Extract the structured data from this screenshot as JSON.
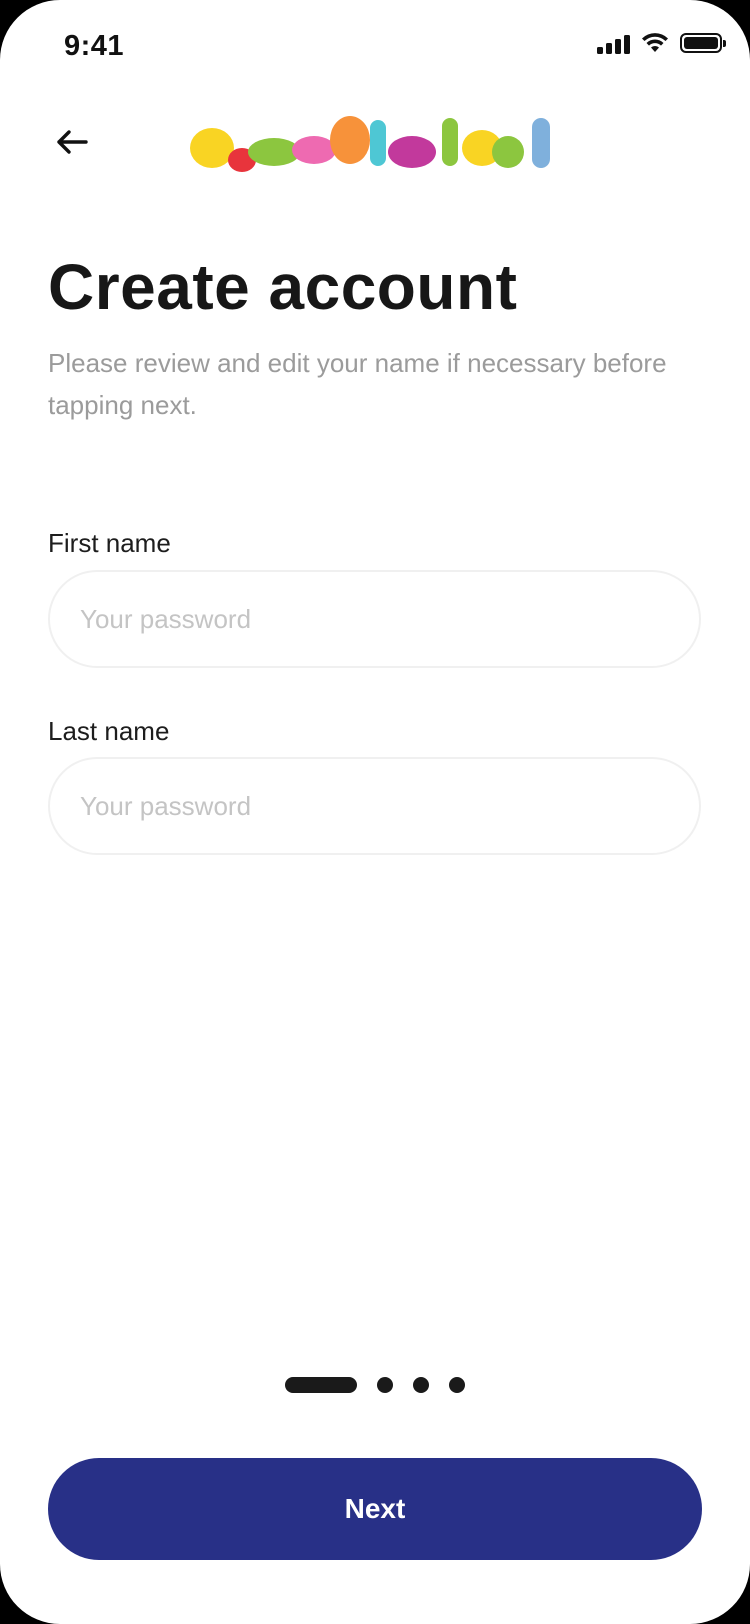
{
  "status_bar": {
    "time": "9:41",
    "icons": [
      "cellular-signal-icon",
      "wifi-icon",
      "battery-icon"
    ]
  },
  "header": {
    "back_icon": "arrow-left-icon",
    "logo_text": "العاب الحسين",
    "logo_colors": [
      "#f9d423",
      "#e8343c",
      "#8cc63f",
      "#f7923a",
      "#ee6ab1",
      "#4ec7d4",
      "#c2399c",
      "#f9d423",
      "#8cc63f",
      "#7fb0dc"
    ]
  },
  "page": {
    "title": "Create account",
    "subtitle": "Please review and edit your name if necessary before tapping next."
  },
  "form": {
    "first_name": {
      "label": "First name",
      "placeholder": "Your password",
      "value": ""
    },
    "last_name": {
      "label": "Last name",
      "placeholder": "Your password",
      "value": ""
    }
  },
  "pagination": {
    "total_steps": 4,
    "current_step": 1
  },
  "actions": {
    "next_label": "Next"
  },
  "colors": {
    "primary_button": "#283087",
    "title_text": "#171717",
    "subtitle_text": "#9b9b9b",
    "placeholder_text": "#c4c4c4",
    "input_border": "#f0f0f0"
  }
}
